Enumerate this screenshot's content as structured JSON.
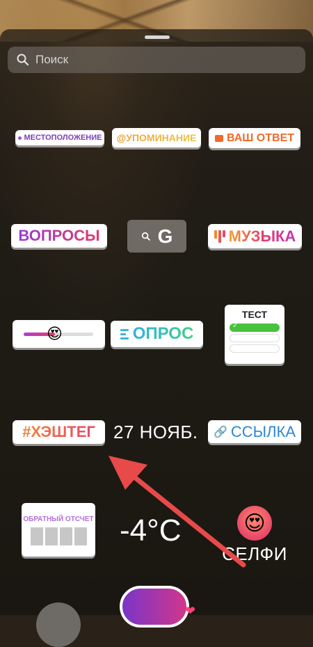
{
  "search": {
    "placeholder": "Поиск"
  },
  "stickers": {
    "location": "МЕСТОПОЛОЖЕНИЕ",
    "mention": "УПОМИНАНИЕ",
    "mention_prefix": "@",
    "your_answer": "ВАШ ОТВЕТ",
    "questions": "ВОПРОСЫ",
    "gif": "G",
    "music": "МУЗЫКА",
    "poll": "ОПРОС",
    "quiz": "ТЕСТ",
    "hashtag": "#ХЭШТЕГ",
    "date": "27 НОЯБ.",
    "link": "ССЫЛКА",
    "countdown": "ОБРАТНЫЙ ОТСЧЕТ",
    "temperature": "-4°C",
    "selfie": "СЕЛФИ"
  },
  "colors": {
    "annotation_arrow": "#e84a4a",
    "link": "#2f86d0",
    "quiz_correct": "#48c23c"
  },
  "icons": {
    "search": "search-icon",
    "gif_search": "search-icon",
    "link": "chain-icon",
    "selfie": "heart-eyes-emoji",
    "slider": "heart-eyes-emoji"
  }
}
